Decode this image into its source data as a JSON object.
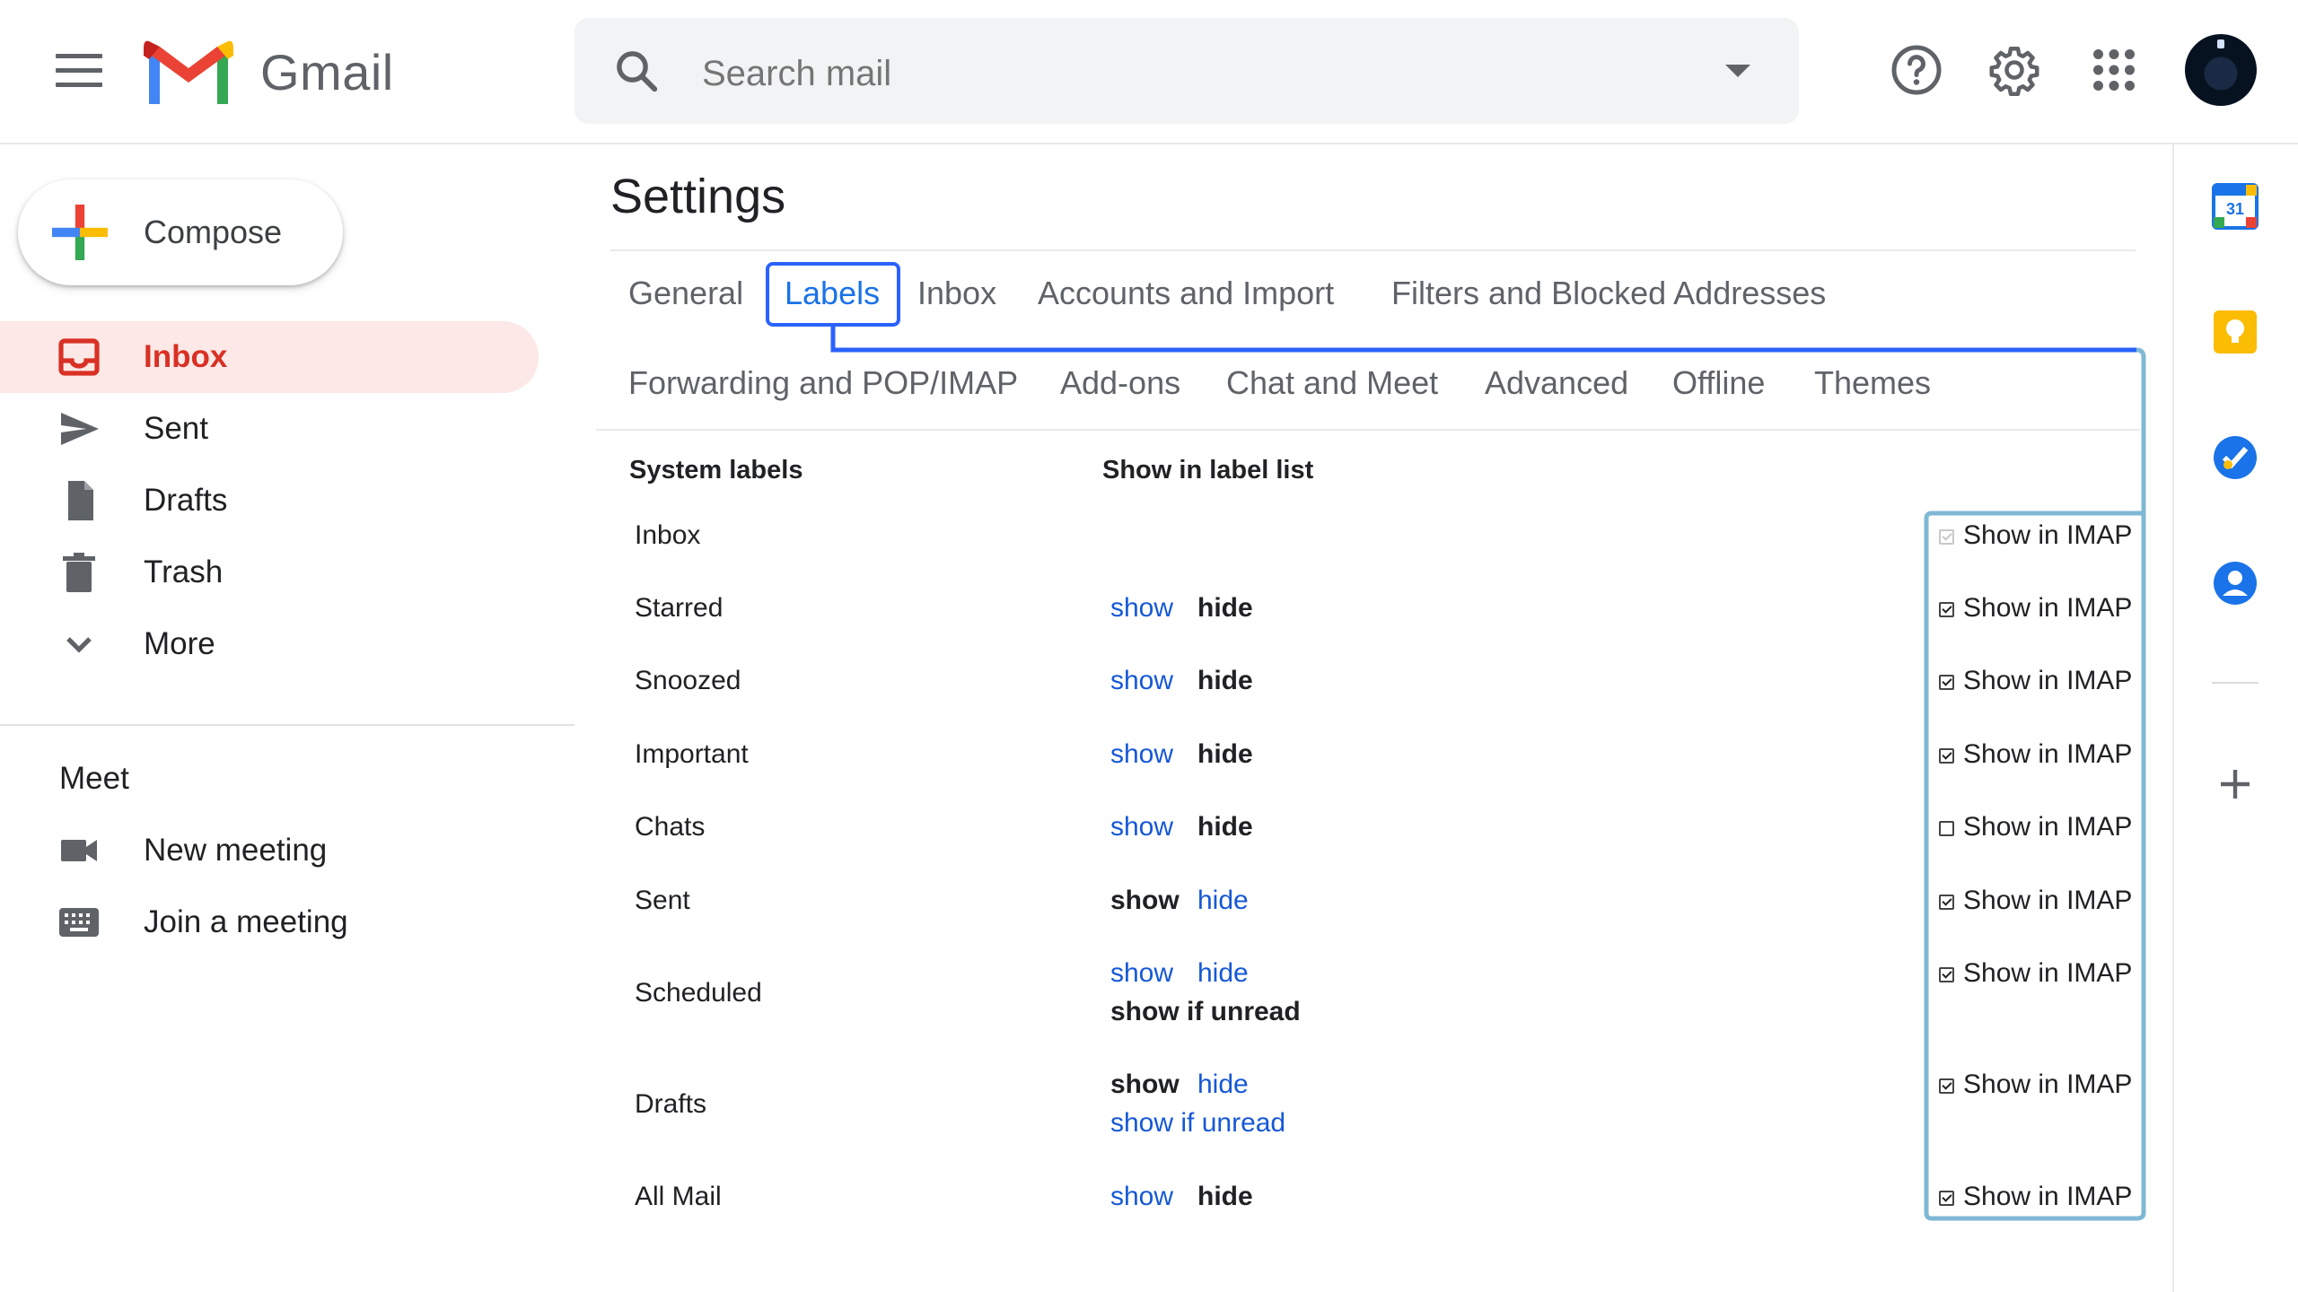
{
  "header": {
    "app_name": "Gmail",
    "search_placeholder": "Search mail"
  },
  "sidebar": {
    "compose_label": "Compose",
    "items": [
      {
        "label": "Inbox",
        "icon": "inbox-icon",
        "active": true
      },
      {
        "label": "Sent",
        "icon": "send-icon"
      },
      {
        "label": "Drafts",
        "icon": "draft-icon"
      },
      {
        "label": "Trash",
        "icon": "trash-icon"
      },
      {
        "label": "More",
        "icon": "chevron-down-icon"
      }
    ],
    "meet": {
      "title": "Meet",
      "items": [
        {
          "label": "New meeting",
          "icon": "video-camera-icon"
        },
        {
          "label": "Join a meeting",
          "icon": "keyboard-icon"
        }
      ]
    }
  },
  "settings": {
    "title": "Settings",
    "tabs_row1": [
      "General",
      "Labels",
      "Inbox",
      "Accounts and Import",
      "Filters and Blocked Addresses"
    ],
    "tabs_row2": [
      "Forwarding and POP/IMAP",
      "Add-ons",
      "Chat and Meet",
      "Advanced",
      "Offline",
      "Themes"
    ],
    "active_tab": "Labels",
    "columns": {
      "system_labels": "System labels",
      "show_in_label_list": "Show in label list"
    },
    "imap_text": "Show in IMAP",
    "rows": [
      {
        "label": "Inbox",
        "imap": "checked-disabled"
      },
      {
        "label": "Starred",
        "show": "show",
        "hide": "hide",
        "selected": "hide",
        "imap": "checked"
      },
      {
        "label": "Snoozed",
        "show": "show",
        "hide": "hide",
        "selected": "hide",
        "imap": "checked"
      },
      {
        "label": "Important",
        "show": "show",
        "hide": "hide",
        "selected": "hide",
        "imap": "checked"
      },
      {
        "label": "Chats",
        "show": "show",
        "hide": "hide",
        "selected": "hide",
        "imap": "unchecked"
      },
      {
        "label": "Sent",
        "show": "show",
        "hide": "hide",
        "selected": "show",
        "imap": "checked"
      },
      {
        "label": "Scheduled",
        "show": "show",
        "hide": "hide",
        "unread": "show if unread",
        "selected": "show if unread",
        "imap": "checked"
      },
      {
        "label": "Drafts",
        "show": "show",
        "hide": "hide",
        "unread": "show if unread",
        "selected": "show",
        "imap": "checked"
      },
      {
        "label": "All Mail",
        "show": "show",
        "hide": "hide",
        "selected": "hide",
        "imap": "checked"
      }
    ]
  },
  "side_panel": {
    "icons": [
      "calendar-icon",
      "keep-icon",
      "tasks-icon",
      "contacts-icon",
      "add-icon"
    ],
    "calendar_day": "31"
  }
}
